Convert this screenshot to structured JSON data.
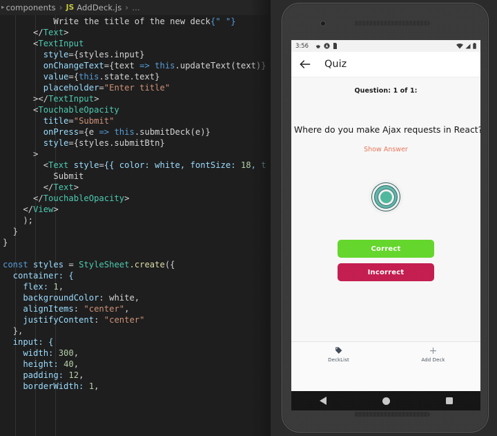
{
  "editor": {
    "breadcrumb": {
      "folder": "components",
      "file": "AddDeck.js",
      "file_icon": "JS",
      "separator": "›",
      "overflow": "…"
    },
    "code_lines": [
      [
        [
          "  ",
          "t-plain"
        ],
        [
          "        Write the title of the new deck",
          "t-plain"
        ],
        [
          "{\" \"}",
          "t-brace"
        ]
      ],
      [
        [
          "      </",
          "t-plain"
        ],
        [
          "Text",
          "t-tag"
        ],
        [
          ">",
          "t-plain"
        ]
      ],
      [
        [
          "      <",
          "t-plain"
        ],
        [
          "TextInput",
          "t-tag"
        ]
      ],
      [
        [
          "        ",
          "t-plain"
        ],
        [
          "style",
          "t-attr"
        ],
        [
          "=",
          "t-plain"
        ],
        [
          "{styles.input}",
          "t-plain"
        ]
      ],
      [
        [
          "        ",
          "t-plain"
        ],
        [
          "onChangeText",
          "t-attr"
        ],
        [
          "=",
          "t-plain"
        ],
        [
          "{text ",
          "t-plain"
        ],
        [
          "=>",
          "t-kw"
        ],
        [
          " ",
          "t-plain"
        ],
        [
          "this",
          "t-this"
        ],
        [
          ".updateText(text)}",
          "t-plain"
        ]
      ],
      [
        [
          "        ",
          "t-plain"
        ],
        [
          "value",
          "t-attr"
        ],
        [
          "=",
          "t-plain"
        ],
        [
          "{",
          "t-plain"
        ],
        [
          "this",
          "t-this"
        ],
        [
          ".state.text}",
          "t-plain"
        ]
      ],
      [
        [
          "        ",
          "t-plain"
        ],
        [
          "placeholder",
          "t-attr"
        ],
        [
          "=",
          "t-plain"
        ],
        [
          "\"Enter title\"",
          "t-str"
        ]
      ],
      [
        [
          "      ></",
          "t-plain"
        ],
        [
          "TextInput",
          "t-tag"
        ],
        [
          ">",
          "t-plain"
        ]
      ],
      [
        [
          "      <",
          "t-plain"
        ],
        [
          "TouchableOpacity",
          "t-tag"
        ]
      ],
      [
        [
          "        ",
          "t-plain"
        ],
        [
          "title",
          "t-attr"
        ],
        [
          "=",
          "t-plain"
        ],
        [
          "\"Submit\"",
          "t-str"
        ]
      ],
      [
        [
          "        ",
          "t-plain"
        ],
        [
          "onPress",
          "t-attr"
        ],
        [
          "=",
          "t-plain"
        ],
        [
          "{e ",
          "t-plain"
        ],
        [
          "=>",
          "t-kw"
        ],
        [
          " ",
          "t-plain"
        ],
        [
          "this",
          "t-this"
        ],
        [
          ".submitDeck(e)}",
          "t-plain"
        ]
      ],
      [
        [
          "        ",
          "t-plain"
        ],
        [
          "style",
          "t-attr"
        ],
        [
          "=",
          "t-plain"
        ],
        [
          "{styles.submitBtn}",
          "t-plain"
        ]
      ],
      [
        [
          "      >",
          "t-plain"
        ]
      ],
      [
        [
          "        <",
          "t-plain"
        ],
        [
          "Text",
          "t-tag"
        ],
        [
          " ",
          "t-plain"
        ],
        [
          "style",
          "t-attr"
        ],
        [
          "=",
          "t-plain"
        ],
        [
          "{{ color: white, fontSize: ",
          "t-attr"
        ],
        [
          "18",
          "t-num"
        ],
        [
          ", t",
          "t-attr"
        ]
      ],
      [
        [
          "          Submit",
          "t-plain"
        ]
      ],
      [
        [
          "        </",
          "t-plain"
        ],
        [
          "Text",
          "t-tag"
        ],
        [
          ">",
          "t-plain"
        ]
      ],
      [
        [
          "      </",
          "t-plain"
        ],
        [
          "TouchableOpacity",
          "t-tag"
        ],
        [
          ">",
          "t-plain"
        ]
      ],
      [
        [
          "    </",
          "t-plain"
        ],
        [
          "View",
          "t-tag"
        ],
        [
          ">",
          "t-plain"
        ]
      ],
      [
        [
          "    );",
          "t-plain"
        ]
      ],
      [
        [
          "  }",
          "t-plain"
        ]
      ],
      [
        [
          "}",
          "t-plain"
        ]
      ],
      [
        [
          "",
          "t-plain"
        ]
      ],
      [
        [
          "const",
          "t-kw"
        ],
        [
          " ",
          "t-plain"
        ],
        [
          "styles",
          "t-var"
        ],
        [
          " = ",
          "t-plain"
        ],
        [
          "StyleSheet",
          "t-tag"
        ],
        [
          ".",
          "t-plain"
        ],
        [
          "create",
          "t-fn"
        ],
        [
          "({",
          "t-plain"
        ]
      ],
      [
        [
          "  container: {",
          "t-prop"
        ]
      ],
      [
        [
          "    flex: ",
          "t-prop"
        ],
        [
          "1",
          "t-num"
        ],
        [
          ",",
          "t-plain"
        ]
      ],
      [
        [
          "    backgroundColor",
          "t-prop"
        ],
        [
          ": ",
          "t-plain"
        ],
        [
          "white",
          "t-white"
        ],
        [
          ",",
          "t-plain"
        ]
      ],
      [
        [
          "    alignItems",
          "t-prop"
        ],
        [
          ": ",
          "t-plain"
        ],
        [
          "\"center\"",
          "t-str"
        ],
        [
          ",",
          "t-plain"
        ]
      ],
      [
        [
          "    justifyContent",
          "t-prop"
        ],
        [
          ": ",
          "t-plain"
        ],
        [
          "\"center\"",
          "t-str"
        ]
      ],
      [
        [
          "  },",
          "t-plain"
        ]
      ],
      [
        [
          "  input: {",
          "t-prop"
        ]
      ],
      [
        [
          "    width: ",
          "t-prop"
        ],
        [
          "300",
          "t-num"
        ],
        [
          ",",
          "t-plain"
        ]
      ],
      [
        [
          "    height: ",
          "t-prop"
        ],
        [
          "40",
          "t-num"
        ],
        [
          ",",
          "t-plain"
        ]
      ],
      [
        [
          "    padding: ",
          "t-prop"
        ],
        [
          "12",
          "t-num"
        ],
        [
          ",",
          "t-plain"
        ]
      ],
      [
        [
          "    borderWidth: ",
          "t-prop"
        ],
        [
          "1",
          "t-num"
        ],
        [
          ",",
          "t-plain"
        ]
      ]
    ]
  },
  "emulator": {
    "status_bar": {
      "time": "3:56",
      "left_icons": [
        "gear-icon",
        "android-studio-icon",
        "sdcard-icon"
      ],
      "right_icons": [
        "wifi-icon",
        "signal-icon",
        "battery-icon"
      ]
    },
    "app_bar": {
      "back_icon": "back-arrow-icon",
      "title": "Quiz"
    },
    "quiz": {
      "question_counter": "Question: 1 of 1:",
      "question_text": "Where do you make Ajax requests in React? ?",
      "show_answer_label": "Show Answer",
      "spinner": "loading-spinner",
      "correct_label": "Correct",
      "incorrect_label": "Incorrect",
      "correct_color": "#64d62c",
      "incorrect_color": "#c41e50",
      "show_answer_color": "#e8765a",
      "spinner_color": "#4fb89d"
    },
    "tabs": [
      {
        "label": "DeckList",
        "icon": "tag-icon"
      },
      {
        "label": "Add Deck",
        "icon": "plus-icon"
      }
    ],
    "nav_bar": {
      "back": "nav-back-icon",
      "home": "nav-home-icon",
      "recents": "nav-recents-icon"
    }
  }
}
